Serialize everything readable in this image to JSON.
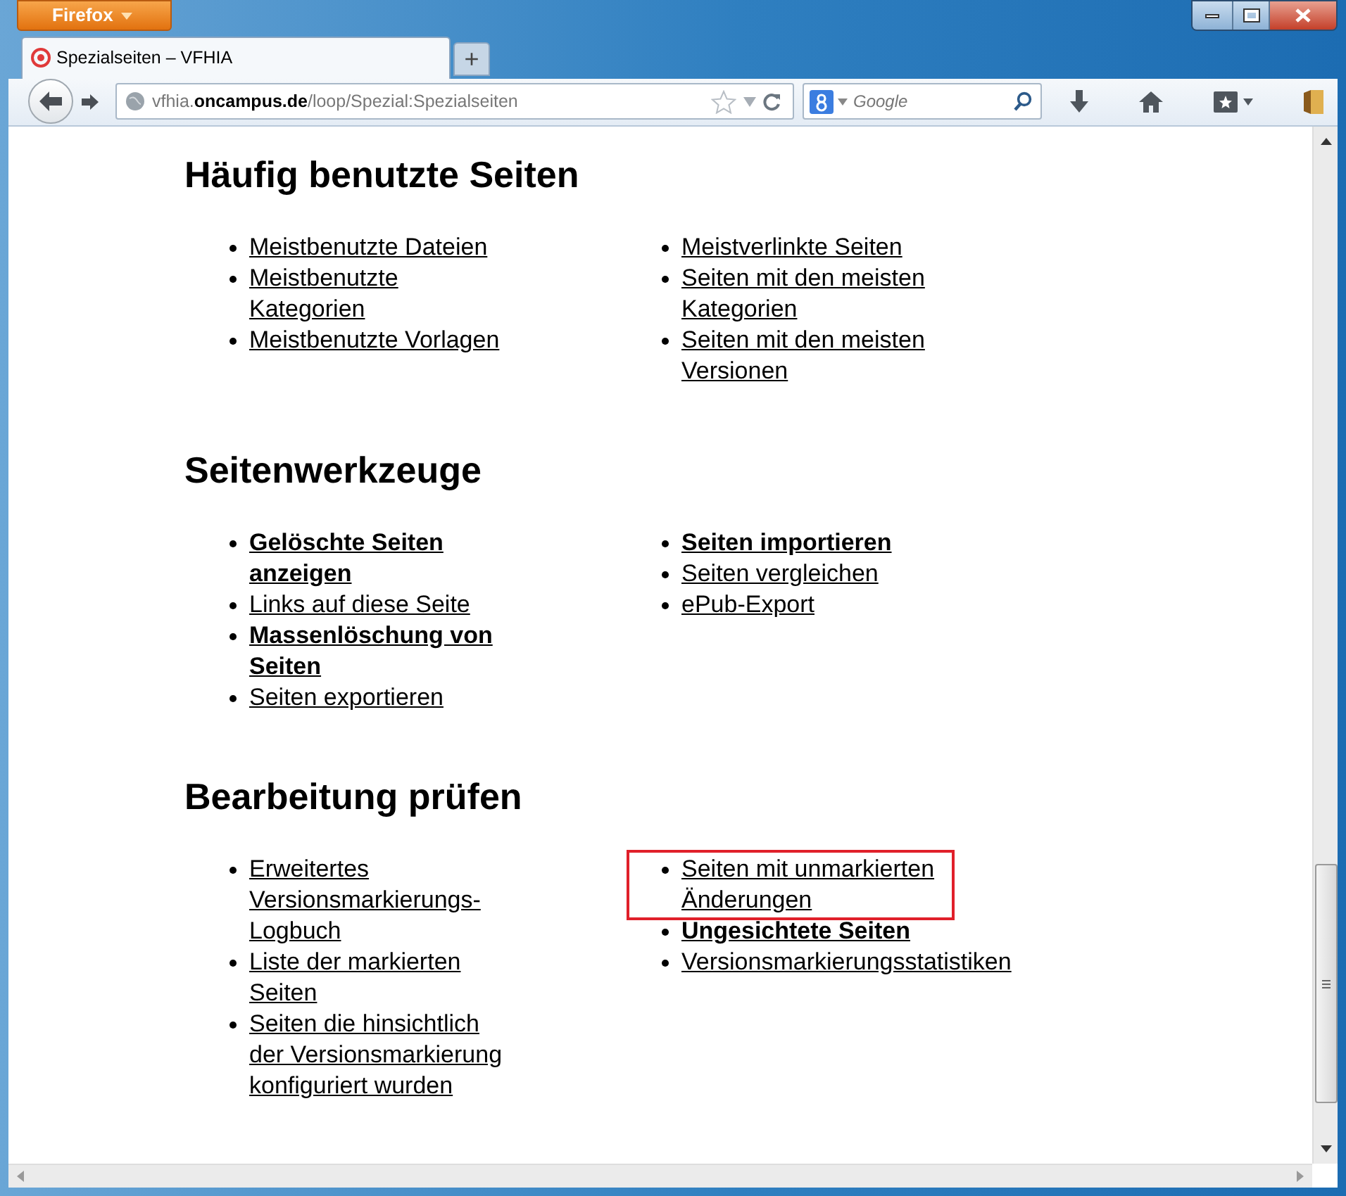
{
  "browser": {
    "menu_button": "Firefox",
    "tabs": [
      {
        "title": "Spezialseiten – VFHIA",
        "selected": true
      }
    ],
    "new_tab": "+",
    "url": "vfhia.**oncampus.de**/loop/Spezial:Spezialseiten",
    "search": {
      "placeholder": "Google"
    }
  },
  "sections": [
    {
      "heading": "Häufig benutzte Seiten",
      "columns": [
        [
          {
            "label": "Meistbenutzte Dateien",
            "bold": false,
            "highlighted": false
          },
          {
            "label": "Meistbenutzte Kategorien",
            "bold": false,
            "highlighted": false
          },
          {
            "label": "Meistbenutzte Vorlagen",
            "bold": false,
            "highlighted": false
          }
        ],
        [
          {
            "label": "Meistverlinkte Seiten",
            "bold": false,
            "highlighted": false
          },
          {
            "label": "Seiten mit den meisten Kategorien",
            "bold": false,
            "highlighted": false
          },
          {
            "label": "Seiten mit den meisten Versionen",
            "bold": false,
            "highlighted": false
          }
        ]
      ]
    },
    {
      "heading": "Seitenwerkzeuge",
      "columns": [
        [
          {
            "label": "Gelöschte Seiten anzeigen",
            "bold": true,
            "highlighted": false
          },
          {
            "label": "Links auf diese Seite",
            "bold": false,
            "highlighted": false
          },
          {
            "label": "Massenlöschung von Seiten",
            "bold": true,
            "highlighted": false
          },
          {
            "label": "Seiten exportieren",
            "bold": false,
            "highlighted": false
          }
        ],
        [
          {
            "label": "Seiten importieren",
            "bold": true,
            "highlighted": false
          },
          {
            "label": "Seiten vergleichen",
            "bold": false,
            "highlighted": false
          },
          {
            "label": "ePub-Export",
            "bold": false,
            "highlighted": false
          }
        ]
      ]
    },
    {
      "heading": "Bearbeitung prüfen",
      "columns": [
        [
          {
            "label": "Erweitertes Versionsmarkierungs-Logbuch",
            "bold": false,
            "highlighted": false
          },
          {
            "label": "Liste der markierten Seiten",
            "bold": false,
            "highlighted": false
          },
          {
            "label": "Seiten die hinsichtlich der Versionsmarkierung konfiguriert wurden",
            "bold": false,
            "highlighted": false
          }
        ],
        [
          {
            "label": "Seiten mit unmarkierten Änderungen",
            "bold": false,
            "highlighted": true
          },
          {
            "label": "Ungesichtete Seiten",
            "bold": true,
            "highlighted": false
          },
          {
            "label": "Versionsmarkierungsstatistiken",
            "bold": false,
            "highlighted": false
          }
        ]
      ]
    }
  ]
}
